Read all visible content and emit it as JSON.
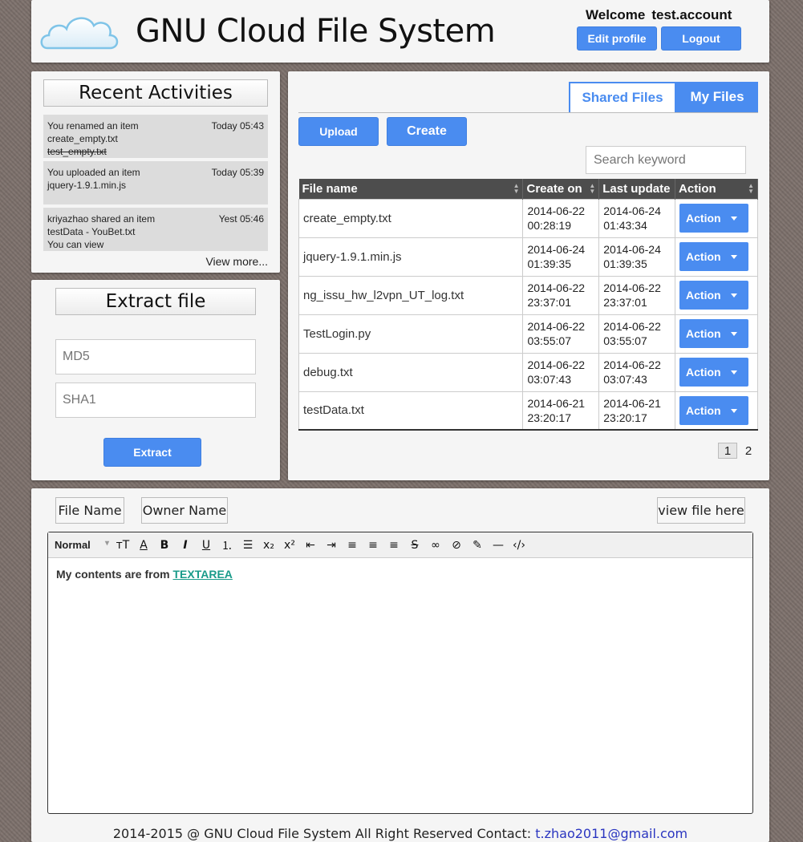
{
  "header": {
    "title": "GNU Cloud File System",
    "welcome_label": "Welcome",
    "username": "test.account",
    "edit_profile": "Edit profile",
    "logout": "Logout"
  },
  "recent": {
    "heading": "Recent Activities",
    "items": [
      {
        "line1": "You renamed an item",
        "line2": "create_empty.txt",
        "line3": "test_empty.txt",
        "time": "Today 05:43"
      },
      {
        "line1": "You uploaded an item",
        "line2": "jquery-1.9.1.min.js",
        "line3": "",
        "time": "Today 05:39"
      },
      {
        "line1": "kriyazhao shared an item",
        "line2": "testData - YouBet.txt",
        "line3": "You can view",
        "time": "Yest 05:46"
      }
    ],
    "view_more": "View more..."
  },
  "extract": {
    "heading": "Extract file",
    "md5_placeholder": "MD5",
    "sha1_placeholder": "SHA1",
    "button": "Extract"
  },
  "files": {
    "tabs": [
      "Shared Files",
      "My Files"
    ],
    "upload": "Upload",
    "create": "Create",
    "search_placeholder": "Search keyword",
    "columns": [
      "File name",
      "Create on",
      "Last update",
      "Action"
    ],
    "rows": [
      {
        "name": "create_empty.txt",
        "created_date": "2014-06-22",
        "created_time": "00:28:19",
        "updated_date": "2014-06-24",
        "updated_time": "01:43:34",
        "action": "Action"
      },
      {
        "name": "jquery-1.9.1.min.js",
        "created_date": "2014-06-24",
        "created_time": "01:39:35",
        "updated_date": "2014-06-24",
        "updated_time": "01:39:35",
        "action": "Action"
      },
      {
        "name": "ng_issu_hw_l2vpn_UT_log.txt",
        "created_date": "2014-06-22",
        "created_time": "23:37:01",
        "updated_date": "2014-06-22",
        "updated_time": "23:37:01",
        "action": "Action"
      },
      {
        "name": "TestLogin.py",
        "created_date": "2014-06-22",
        "created_time": "03:55:07",
        "updated_date": "2014-06-22",
        "updated_time": "03:55:07",
        "action": "Action"
      },
      {
        "name": "debug.txt",
        "created_date": "2014-06-22",
        "created_time": "03:07:43",
        "updated_date": "2014-06-22",
        "updated_time": "03:07:43",
        "action": "Action"
      },
      {
        "name": "testData.txt",
        "created_date": "2014-06-21",
        "created_time": "23:20:17",
        "updated_date": "2014-06-21",
        "updated_time": "23:20:17",
        "action": "Action"
      }
    ],
    "pages": [
      "1",
      "2"
    ]
  },
  "editor": {
    "file_name_btn": "File Name",
    "owner_name_btn": "Owner Name",
    "view_file_btn": "view file here",
    "format_select": "Normal",
    "content_prefix": "My contents are from ",
    "content_link": "TEXTAREA"
  },
  "footer": {
    "text": "2014-2015 @ GNU Cloud File System All Right Reserved Contact: ",
    "email": "t.zhao2011@gmail.com"
  },
  "colors": {
    "accent": "#4a8cf0",
    "header_bg": "#4d4d4d",
    "panel_bg": "#f5f5f5",
    "link": "#1a9b8a"
  }
}
